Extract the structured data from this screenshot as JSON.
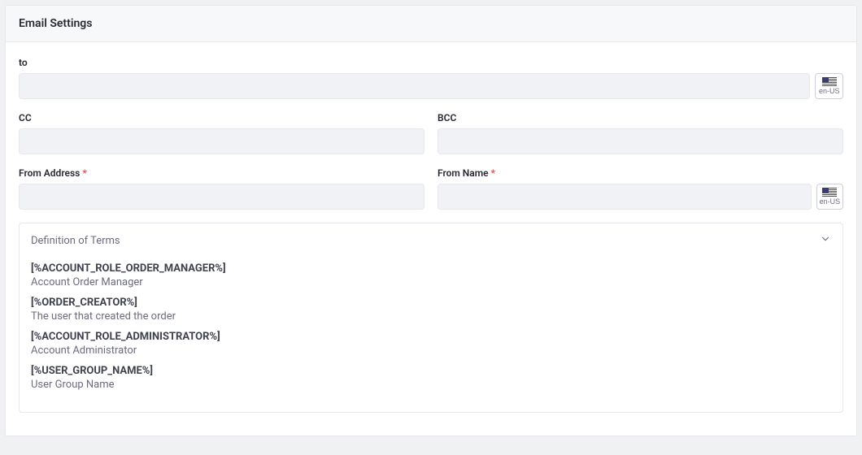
{
  "panel": {
    "title": "Email Settings"
  },
  "fields": {
    "to": {
      "label": "to",
      "value": ""
    },
    "cc": {
      "label": "CC",
      "value": ""
    },
    "bcc": {
      "label": "BCC",
      "value": ""
    },
    "from_address": {
      "label": "From Address",
      "value": ""
    },
    "from_name": {
      "label": "From Name",
      "value": ""
    }
  },
  "locale": {
    "code": "en-US"
  },
  "terms": {
    "title": "Definition of Terms",
    "items": [
      {
        "key": "[%ACCOUNT_ROLE_ORDER_MANAGER%]",
        "desc": "Account Order Manager"
      },
      {
        "key": "[%ORDER_CREATOR%]",
        "desc": "The user that created the order"
      },
      {
        "key": "[%ACCOUNT_ROLE_ADMINISTRATOR%]",
        "desc": "Account Administrator"
      },
      {
        "key": "[%USER_GROUP_NAME%]",
        "desc": "User Group Name"
      }
    ]
  }
}
